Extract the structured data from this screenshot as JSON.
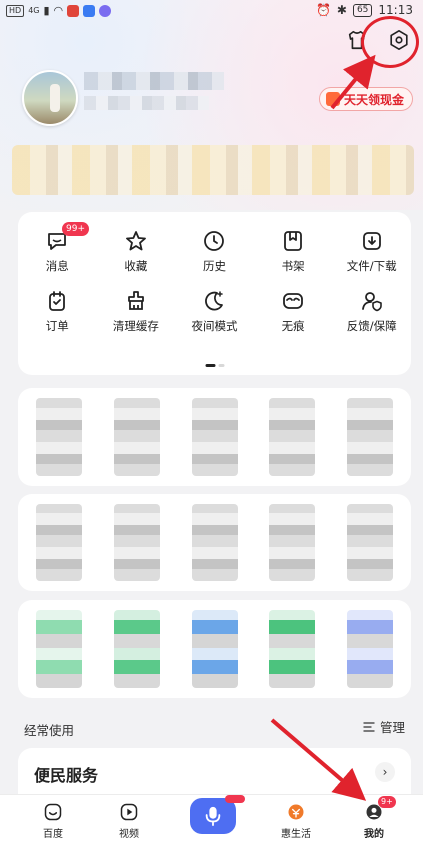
{
  "status_bar": {
    "left_chips": [
      "HD",
      "4G"
    ],
    "battery": "65",
    "time": "11:13"
  },
  "profile": {
    "cash_badge_label": "天天领现金"
  },
  "grid": {
    "items": [
      {
        "label": "消息",
        "icon": "message-icon",
        "badge": "99+"
      },
      {
        "label": "收藏",
        "icon": "star-icon"
      },
      {
        "label": "历史",
        "icon": "clock-icon"
      },
      {
        "label": "书架",
        "icon": "bookmark-icon"
      },
      {
        "label": "文件/下载",
        "icon": "download-icon"
      },
      {
        "label": "订单",
        "icon": "order-icon"
      },
      {
        "label": "清理缓存",
        "icon": "clean-icon"
      },
      {
        "label": "夜间模式",
        "icon": "moon-icon"
      },
      {
        "label": "无痕",
        "icon": "mask-icon"
      },
      {
        "label": "反馈/保障",
        "icon": "feedback-icon"
      }
    ]
  },
  "section": {
    "title": "经常使用",
    "manage_label": "管理"
  },
  "service_card": {
    "title": "便民服务"
  },
  "tabbar": {
    "tabs": [
      {
        "label": "百度",
        "icon": "baidu-icon"
      },
      {
        "label": "视频",
        "icon": "video-icon"
      },
      {
        "label": "惠生活",
        "icon": "life-icon"
      },
      {
        "label": "我的",
        "icon": "profile-icon",
        "badge": "9+"
      }
    ],
    "mic_icon": "mic-icon"
  },
  "colors": {
    "accent": "#4e6ef2",
    "badge": "#f0364f",
    "annotation": "#e0232d"
  }
}
